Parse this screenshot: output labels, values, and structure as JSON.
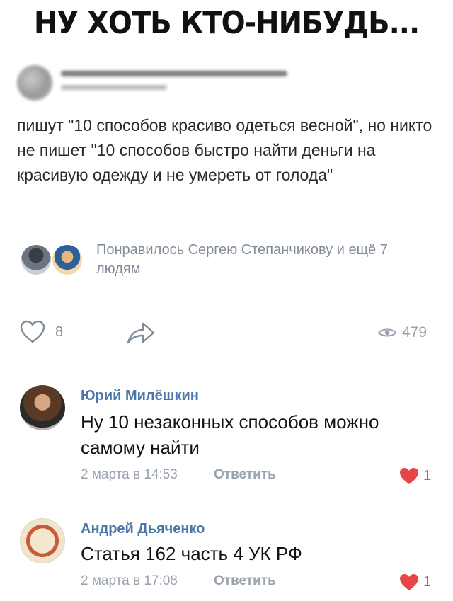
{
  "meme": {
    "title": "НУ ХОТЬ КТО-НИБУДЬ..."
  },
  "post": {
    "text": "пишут \"10 способов красиво одеться весной\", но никто не пишет \"10 способов быстро найти деньги на красивую одежду и не умереть от голода\"",
    "likes_text": "Понравилось Сергею Степанчикову и ещё 7 людям",
    "like_count": "8",
    "views": "479",
    "icons": {
      "like": "heart-outline-icon",
      "share": "share-arrow-icon",
      "views": "eye-icon"
    }
  },
  "comments": [
    {
      "author": "Юрий Милёшкин",
      "text": "Ну 10 незаконных способов можно самому найти",
      "date": "2 марта в 14:53",
      "reply": "Ответить",
      "likes": "1"
    },
    {
      "author": "Андрей Дьяченко",
      "text": "Статья 162 часть 4 УК РФ",
      "date": "2 марта в 17:08",
      "reply": "Ответить",
      "likes": "1"
    }
  ],
  "colors": {
    "link": "#4a76a8",
    "muted": "#818c99",
    "liked": "#e64646"
  }
}
